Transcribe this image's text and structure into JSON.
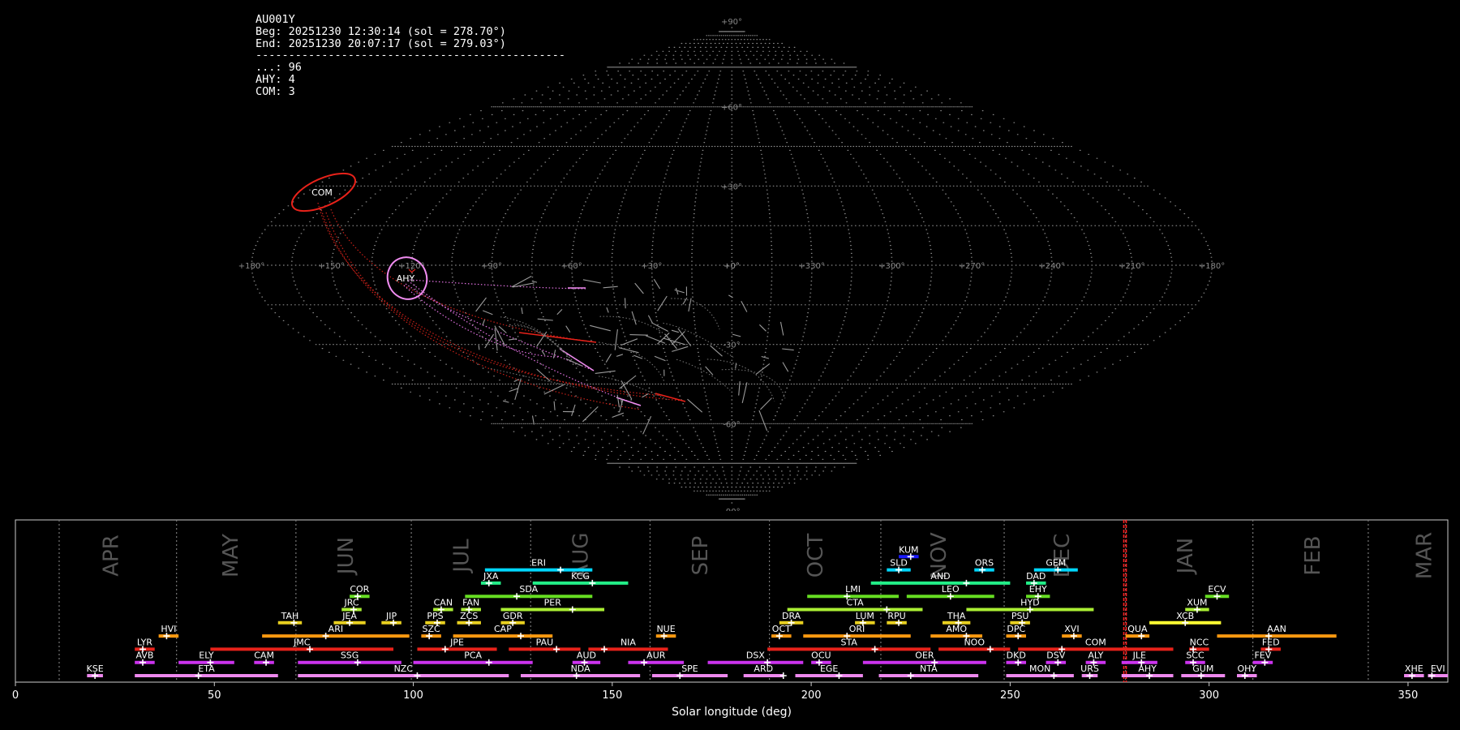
{
  "info": {
    "station": "AU001Y",
    "beg": "Beg: 20251230 12:30:14 (sol = 278.70°)",
    "end": "End: 20251230 20:07:17 (sol = 279.03°)",
    "separator": "-----------------------------------------------",
    "counts": [
      {
        "code": "...",
        "count": "96"
      },
      {
        "code": "AHY",
        "count": "4"
      },
      {
        "code": "COM",
        "count": "3"
      }
    ]
  },
  "sky": {
    "lat_labels": [
      "+90°",
      "+60°",
      "+30°",
      "+0°",
      "-30°",
      "-60°",
      "-90°"
    ],
    "lon_labels": [
      "+180°",
      "+150°",
      "+120°",
      "+90°",
      "+60°",
      "+30°",
      "+0°",
      "+330°",
      "+300°",
      "+270°",
      "+240°",
      "+210°",
      "+180°"
    ],
    "shower_circles": [
      {
        "code": "COM",
        "color": "#e8221a"
      },
      {
        "code": "AHY",
        "color": "#f08cf0"
      }
    ]
  },
  "chart_data": {
    "type": "timeline",
    "xlabel": "Solar longitude (deg)",
    "xlim": [
      0,
      360
    ],
    "xticks": [
      0,
      50,
      100,
      150,
      200,
      250,
      300,
      350
    ],
    "current_sol": 278.87,
    "month_boundaries": [
      11,
      40.5,
      70.5,
      99.5,
      129.5,
      159.5,
      189.5,
      217.5,
      248.5,
      279,
      311,
      340
    ],
    "months": [
      {
        "name": "APR",
        "x": 24
      },
      {
        "name": "MAY",
        "x": 54
      },
      {
        "name": "JUN",
        "x": 83
      },
      {
        "name": "JUL",
        "x": 112
      },
      {
        "name": "AUG",
        "x": 142
      },
      {
        "name": "SEP",
        "x": 172
      },
      {
        "name": "OCT",
        "x": 201
      },
      {
        "name": "NOV",
        "x": 232
      },
      {
        "name": "DEC",
        "x": 263
      },
      {
        "name": "JAN",
        "x": 294
      },
      {
        "name": "FEB",
        "x": 326
      },
      {
        "name": "MAR",
        "x": 354
      }
    ],
    "showers": [
      {
        "code": "KUM",
        "row": 8,
        "start": 222,
        "end": 227,
        "peak": 225,
        "color": "#1a1aff"
      },
      {
        "code": "ERI",
        "row": 7,
        "start": 118,
        "end": 145,
        "peak": 137,
        "color": "#00d8ff"
      },
      {
        "code": "SLD",
        "row": 7,
        "start": 219,
        "end": 225,
        "peak": 222,
        "color": "#00d8ff"
      },
      {
        "code": "ORS",
        "row": 7,
        "start": 241,
        "end": 246,
        "peak": 243,
        "color": "#00d8ff"
      },
      {
        "code": "GEM",
        "row": 7,
        "start": 256,
        "end": 267,
        "peak": 262,
        "color": "#00d8ff"
      },
      {
        "code": "JXA",
        "row": 6,
        "start": 117,
        "end": 122,
        "peak": 119,
        "color": "#22ee88"
      },
      {
        "code": "KCG",
        "row": 6,
        "start": 130,
        "end": 154,
        "peak": 145,
        "color": "#22ee88"
      },
      {
        "code": "AND",
        "row": 6,
        "start": 215,
        "end": 250,
        "peak": 239,
        "color": "#22ee88"
      },
      {
        "code": "DAD",
        "row": 6,
        "start": 254,
        "end": 259,
        "peak": 256,
        "color": "#22ee88"
      },
      {
        "code": "COR",
        "row": 5,
        "start": 84,
        "end": 89,
        "peak": 86,
        "color": "#66dd22"
      },
      {
        "code": "SDA",
        "row": 5,
        "start": 113,
        "end": 145,
        "peak": 126,
        "color": "#66dd22"
      },
      {
        "code": "LMI",
        "row": 5,
        "start": 199,
        "end": 222,
        "peak": 209,
        "color": "#66dd22"
      },
      {
        "code": "LEO",
        "row": 5,
        "start": 224,
        "end": 246,
        "peak": 235,
        "color": "#66dd22"
      },
      {
        "code": "EHY",
        "row": 5,
        "start": 254,
        "end": 260,
        "peak": 257,
        "color": "#66dd22"
      },
      {
        "code": "ECV",
        "row": 5,
        "start": 299,
        "end": 305,
        "peak": 302,
        "color": "#66dd22"
      },
      {
        "code": "JRC",
        "row": 4,
        "start": 82,
        "end": 87,
        "peak": 85,
        "color": "#aaee33"
      },
      {
        "code": "CAN",
        "row": 4,
        "start": 105,
        "end": 110,
        "peak": 107,
        "color": "#aaee33"
      },
      {
        "code": "FAN",
        "row": 4,
        "start": 112,
        "end": 117,
        "peak": 114,
        "color": "#aaee33"
      },
      {
        "code": "PER",
        "row": 4,
        "start": 122,
        "end": 148,
        "peak": 140,
        "color": "#aaee33"
      },
      {
        "code": "CTA",
        "row": 4,
        "start": 194,
        "end": 228,
        "peak": 219,
        "color": "#aaee33"
      },
      {
        "code": "HYD",
        "row": 4,
        "start": 239,
        "end": 271,
        "peak": 255,
        "color": "#aaee33"
      },
      {
        "code": "XUM",
        "row": 4,
        "start": 294,
        "end": 300,
        "peak": 297,
        "color": "#aaee33"
      },
      {
        "code": "TAH",
        "row": 3,
        "start": 66,
        "end": 72,
        "peak": 70,
        "color": "#e8d020"
      },
      {
        "code": "JEA",
        "row": 3,
        "start": 80,
        "end": 88,
        "peak": 84,
        "color": "#e8d020"
      },
      {
        "code": "JIP",
        "row": 3,
        "start": 92,
        "end": 97,
        "peak": 95,
        "color": "#e8d020"
      },
      {
        "code": "PPS",
        "row": 3,
        "start": 103,
        "end": 108,
        "peak": 106,
        "color": "#e8d020"
      },
      {
        "code": "ZCS",
        "row": 3,
        "start": 111,
        "end": 117,
        "peak": 114,
        "color": "#e8d020"
      },
      {
        "code": "GDR",
        "row": 3,
        "start": 122,
        "end": 128,
        "peak": 125,
        "color": "#e8d020"
      },
      {
        "code": "DRA",
        "row": 3,
        "start": 192,
        "end": 198,
        "peak": 195,
        "color": "#e8d020"
      },
      {
        "code": "LUM",
        "row": 3,
        "start": 211,
        "end": 216,
        "peak": 213,
        "color": "#e8d020"
      },
      {
        "code": "RPU",
        "row": 3,
        "start": 219,
        "end": 224,
        "peak": 222,
        "color": "#e8d020"
      },
      {
        "code": "THA",
        "row": 3,
        "start": 233,
        "end": 240,
        "peak": 237,
        "color": "#e8d020"
      },
      {
        "code": "PSU",
        "row": 3,
        "start": 250,
        "end": 255,
        "peak": 253,
        "color": "#e8d020"
      },
      {
        "code": "XCB",
        "row": 3,
        "start": 285,
        "end": 303,
        "peak": 294,
        "color": "#ffff33"
      },
      {
        "code": "HVI",
        "row": 2,
        "start": 36,
        "end": 41,
        "peak": 38,
        "color": "#ff9910"
      },
      {
        "code": "ARI",
        "row": 2,
        "start": 62,
        "end": 99,
        "peak": 78,
        "color": "#ff9910"
      },
      {
        "code": "SZC",
        "row": 2,
        "start": 102,
        "end": 107,
        "peak": 104,
        "color": "#ff9910"
      },
      {
        "code": "CAP",
        "row": 2,
        "start": 110,
        "end": 135,
        "peak": 127,
        "color": "#ff9910"
      },
      {
        "code": "NUE",
        "row": 2,
        "start": 161,
        "end": 166,
        "peak": 163,
        "color": "#ff9910"
      },
      {
        "code": "OCT",
        "row": 2,
        "start": 190,
        "end": 195,
        "peak": 192,
        "color": "#ff9910"
      },
      {
        "code": "ORI",
        "row": 2,
        "start": 198,
        "end": 225,
        "peak": 209,
        "color": "#ff9910"
      },
      {
        "code": "AMO",
        "row": 2,
        "start": 230,
        "end": 243,
        "peak": 239,
        "color": "#ff9910"
      },
      {
        "code": "DPC",
        "row": 2,
        "start": 249,
        "end": 254,
        "peak": 252,
        "color": "#ff9910"
      },
      {
        "code": "XVI",
        "row": 2,
        "start": 263,
        "end": 268,
        "peak": 266,
        "color": "#ff9910"
      },
      {
        "code": "QUA",
        "row": 2,
        "start": 279,
        "end": 285,
        "peak": 283,
        "color": "#ff9910"
      },
      {
        "code": "AAN",
        "row": 2,
        "start": 302,
        "end": 332,
        "peak": 315,
        "color": "#ff9910"
      },
      {
        "code": "LYR",
        "row": 1,
        "start": 30,
        "end": 35,
        "peak": 32,
        "color": "#e8221a"
      },
      {
        "code": "JMC",
        "row": 1,
        "start": 49,
        "end": 95,
        "peak": 74,
        "color": "#e8221a"
      },
      {
        "code": "JPE",
        "row": 1,
        "start": 101,
        "end": 121,
        "peak": 108,
        "color": "#e8221a"
      },
      {
        "code": "PAU",
        "row": 1,
        "start": 124,
        "end": 142,
        "peak": 136,
        "color": "#e8221a"
      },
      {
        "code": "NIA",
        "row": 1,
        "start": 144,
        "end": 164,
        "peak": 148,
        "color": "#e8221a"
      },
      {
        "code": "STA",
        "row": 1,
        "start": 189,
        "end": 230,
        "peak": 216,
        "color": "#e8221a"
      },
      {
        "code": "NOO",
        "row": 1,
        "start": 232,
        "end": 250,
        "peak": 245,
        "color": "#e8221a"
      },
      {
        "code": "COM",
        "row": 1,
        "start": 252,
        "end": 291,
        "peak": 263,
        "color": "#e8221a"
      },
      {
        "code": "NCC",
        "row": 1,
        "start": 295,
        "end": 300,
        "peak": 296,
        "color": "#e8221a"
      },
      {
        "code": "FED",
        "row": 1,
        "start": 313,
        "end": 318,
        "peak": 315,
        "color": "#e8221a"
      },
      {
        "code": "AVB",
        "row": 0,
        "start": 30,
        "end": 35,
        "peak": 32,
        "color": "#cc33ee"
      },
      {
        "code": "ELY",
        "row": 0,
        "start": 41,
        "end": 55,
        "peak": 49,
        "color": "#cc33ee"
      },
      {
        "code": "CAM",
        "row": 0,
        "start": 60,
        "end": 65,
        "peak": 63,
        "color": "#cc33ee"
      },
      {
        "code": "SSG",
        "row": 0,
        "start": 71,
        "end": 97,
        "peak": 86,
        "color": "#cc33ee"
      },
      {
        "code": "PCA",
        "row": 0,
        "start": 100,
        "end": 130,
        "peak": 119,
        "color": "#cc33ee"
      },
      {
        "code": "AUD",
        "row": 0,
        "start": 140,
        "end": 147,
        "peak": 143,
        "color": "#cc33ee"
      },
      {
        "code": "AUR",
        "row": 0,
        "start": 154,
        "end": 168,
        "peak": 158,
        "color": "#cc33ee"
      },
      {
        "code": "DSX",
        "row": 0,
        "start": 174,
        "end": 198,
        "peak": 189,
        "color": "#cc33ee"
      },
      {
        "code": "OCU",
        "row": 0,
        "start": 200,
        "end": 205,
        "peak": 202,
        "color": "#cc33ee"
      },
      {
        "code": "OER",
        "row": 0,
        "start": 213,
        "end": 244,
        "peak": 231,
        "color": "#cc33ee"
      },
      {
        "code": "DKD",
        "row": 0,
        "start": 249,
        "end": 254,
        "peak": 252,
        "color": "#cc33ee"
      },
      {
        "code": "DSV",
        "row": 0,
        "start": 259,
        "end": 264,
        "peak": 262,
        "color": "#cc33ee"
      },
      {
        "code": "ALY",
        "row": 0,
        "start": 269,
        "end": 274,
        "peak": 271,
        "color": "#cc33ee"
      },
      {
        "code": "JLE",
        "row": 0,
        "start": 278,
        "end": 287,
        "peak": 283,
        "color": "#cc33ee"
      },
      {
        "code": "SCC",
        "row": 0,
        "start": 294,
        "end": 299,
        "peak": 296,
        "color": "#cc33ee"
      },
      {
        "code": "FEV",
        "row": 0,
        "start": 311,
        "end": 316,
        "peak": 314,
        "color": "#cc33ee"
      },
      {
        "code": "KSE",
        "row": -1,
        "start": 18,
        "end": 22,
        "peak": 20,
        "color": "#ee88ee"
      },
      {
        "code": "ETA",
        "row": -1,
        "start": 30,
        "end": 66,
        "peak": 46,
        "color": "#ee88ee"
      },
      {
        "code": "NZC",
        "row": -1,
        "start": 71,
        "end": 124,
        "peak": 101,
        "color": "#ee88ee"
      },
      {
        "code": "NDA",
        "row": -1,
        "start": 127,
        "end": 157,
        "peak": 141,
        "color": "#ee88ee"
      },
      {
        "code": "SPE",
        "row": -1,
        "start": 160,
        "end": 179,
        "peak": 167,
        "color": "#ee88ee"
      },
      {
        "code": "ARD",
        "row": -1,
        "start": 183,
        "end": 193,
        "peak": 193,
        "color": "#ee88ee"
      },
      {
        "code": "EGE",
        "row": -1,
        "start": 196,
        "end": 213,
        "peak": 207,
        "color": "#ee88ee"
      },
      {
        "code": "NTA",
        "row": -1,
        "start": 217,
        "end": 242,
        "peak": 225,
        "color": "#ee88ee"
      },
      {
        "code": "MON",
        "row": -1,
        "start": 249,
        "end": 266,
        "peak": 261,
        "color": "#ee88ee"
      },
      {
        "code": "URS",
        "row": -1,
        "start": 268,
        "end": 272,
        "peak": 270,
        "color": "#ee88ee"
      },
      {
        "code": "AHY",
        "row": -1,
        "start": 278,
        "end": 291,
        "peak": 285,
        "color": "#ee88ee"
      },
      {
        "code": "GUM",
        "row": -1,
        "start": 293,
        "end": 304,
        "peak": 298,
        "color": "#ee88ee"
      },
      {
        "code": "OHY",
        "row": -1,
        "start": 307,
        "end": 312,
        "peak": 309,
        "color": "#ee88ee"
      },
      {
        "code": "XHE",
        "row": -1,
        "start": 349,
        "end": 354,
        "peak": 351,
        "color": "#ee88ee"
      },
      {
        "code": "EVI",
        "row": -1,
        "start": 355,
        "end": 360,
        "peak": 356,
        "color": "#ee88ee"
      }
    ]
  }
}
